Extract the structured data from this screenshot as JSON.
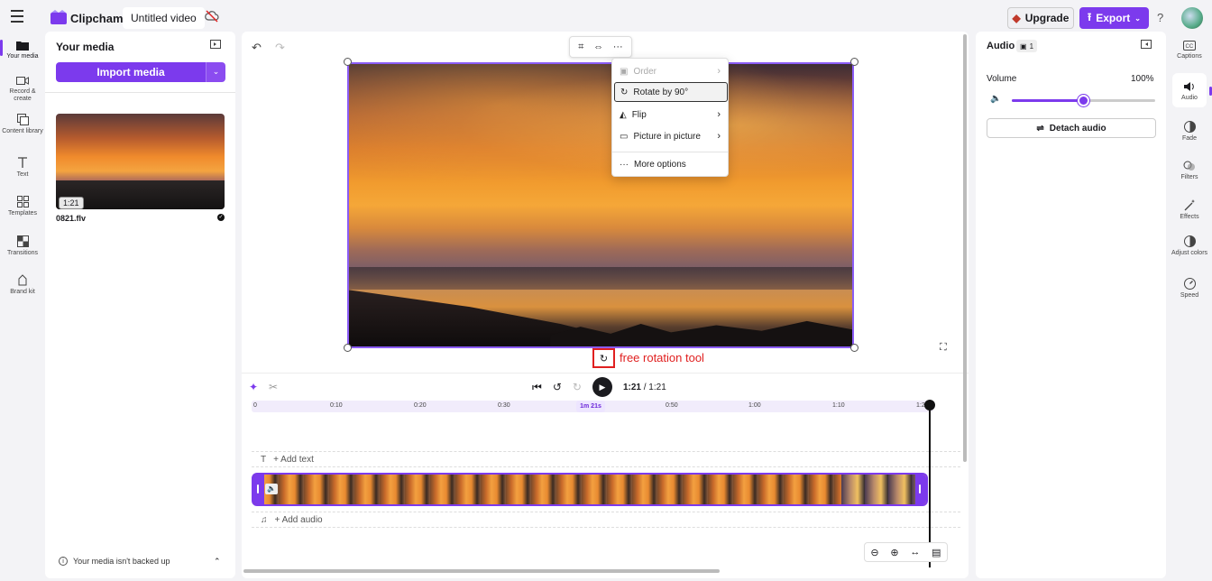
{
  "app": {
    "name": "Clipchamp",
    "project_title": "Untitled video",
    "upgrade_label": "Upgrade",
    "export_label": "Export",
    "help_label": "?"
  },
  "left_nav": [
    {
      "label": "Your media",
      "icon": "folder-icon"
    },
    {
      "label": "Record & create",
      "icon": "camera-icon"
    },
    {
      "label": "Content library",
      "icon": "library-icon"
    },
    {
      "label": "Text",
      "icon": "text-icon"
    },
    {
      "label": "Templates",
      "icon": "templates-icon"
    },
    {
      "label": "Transitions",
      "icon": "transitions-icon"
    },
    {
      "label": "Brand kit",
      "icon": "brand-kit-icon"
    }
  ],
  "media_panel": {
    "title": "Your media",
    "import_label": "Import media",
    "file": {
      "name": "0821.flv",
      "duration": "1:21"
    },
    "backup_text": "Your media isn't backed up"
  },
  "context_menu": {
    "items": [
      {
        "label": "Order",
        "disabled": true,
        "submenu": true
      },
      {
        "label": "Rotate by 90°",
        "disabled": false,
        "submenu": false
      },
      {
        "label": "Flip",
        "disabled": false,
        "submenu": true
      },
      {
        "label": "Picture in picture",
        "disabled": false,
        "submenu": true
      },
      {
        "label": "More options",
        "disabled": false,
        "submenu": false
      }
    ]
  },
  "annotation": {
    "label": "free rotation tool",
    "color": "#e02020"
  },
  "playback": {
    "current": "1:21",
    "total": "/ 1:21"
  },
  "ruler": {
    "ticks": [
      "0",
      "0:10",
      "0:20",
      "0:30",
      "0:50",
      "1:00",
      "1:10",
      "1:2"
    ],
    "current_pill": "1m 21s"
  },
  "tracks": {
    "text_label": "+ Add text",
    "audio_label": "+ Add audio"
  },
  "audio_panel": {
    "title": "Audio",
    "badge": "1",
    "volume_label": "Volume",
    "volume_value": "100%",
    "volume_fraction": 0.5,
    "detach_label": "Detach audio"
  },
  "right_nav": [
    {
      "label": "Captions",
      "icon": "captions-icon"
    },
    {
      "label": "Audio",
      "icon": "speaker-icon"
    },
    {
      "label": "Fade",
      "icon": "fade-icon"
    },
    {
      "label": "Filters",
      "icon": "filters-icon"
    },
    {
      "label": "Effects",
      "icon": "effects-icon"
    },
    {
      "label": "Adjust colors",
      "icon": "adjust-colors-icon"
    },
    {
      "label": "Speed",
      "icon": "speed-icon"
    }
  ],
  "colors": {
    "accent": "#7c3aed",
    "annotation": "#e02020"
  }
}
